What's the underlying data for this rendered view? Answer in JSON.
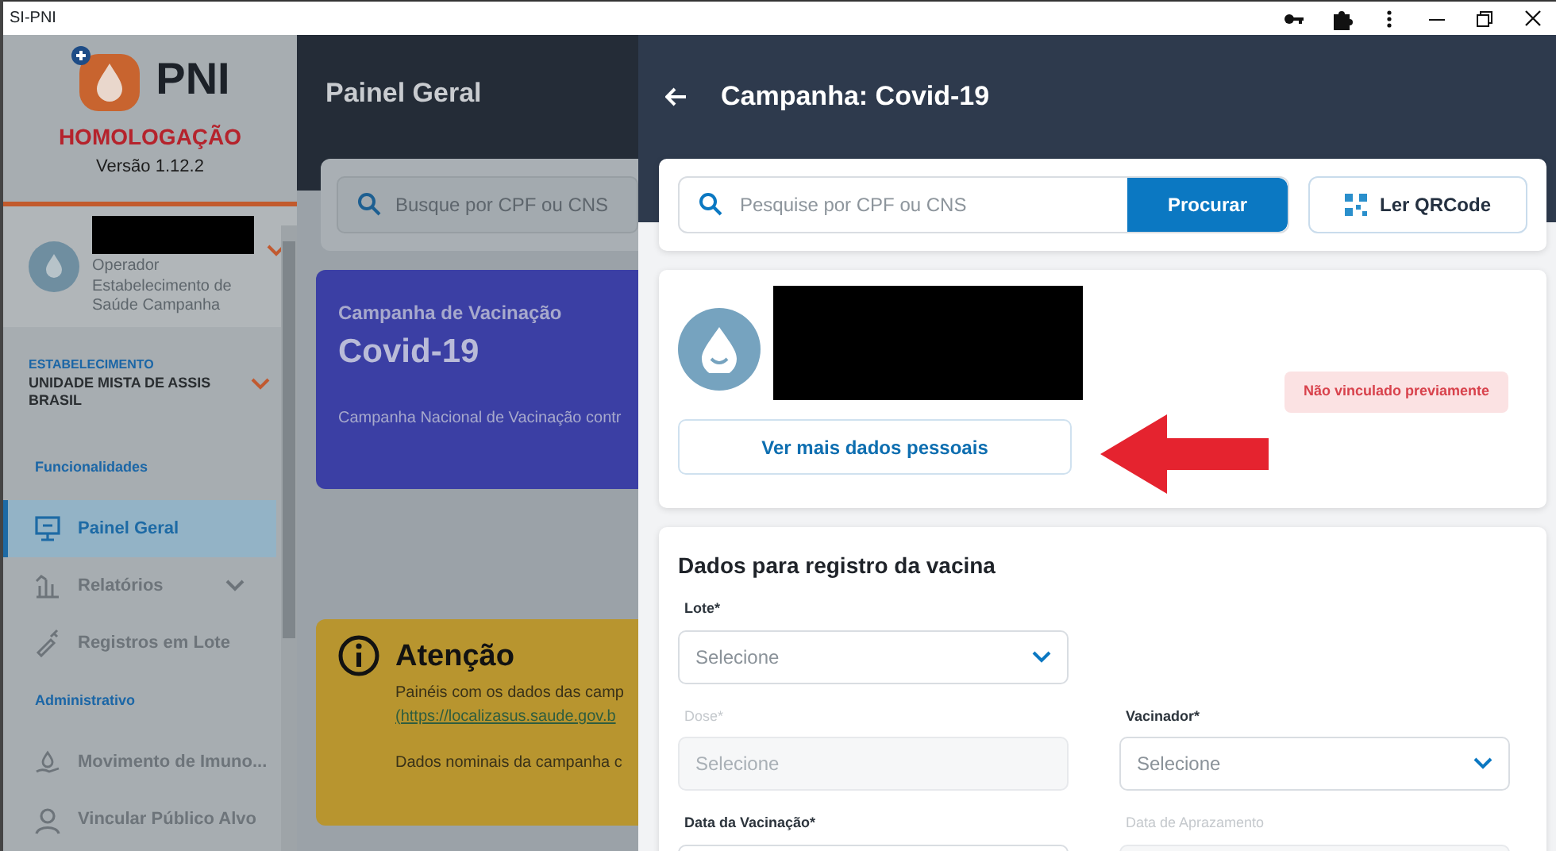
{
  "window": {
    "title": "SI-PNI"
  },
  "sidebar": {
    "logo_text": "PNI",
    "environment": "HOMOLOGAÇÃO",
    "version": "Versão 1.12.2",
    "user": {
      "role": "Operador Estabelecimento de Saúde Campanha"
    },
    "establishment": {
      "heading": "ESTABELECIMENTO",
      "name": "UNIDADE MISTA DE ASSIS BRASIL"
    },
    "sections": [
      {
        "heading": "Funcionalidades",
        "items": [
          {
            "label": "Painel Geral",
            "selected": true,
            "expandable": false
          },
          {
            "label": "Relatórios",
            "selected": false,
            "expandable": true
          },
          {
            "label": "Registros em Lote",
            "selected": false,
            "expandable": false
          }
        ]
      },
      {
        "heading": "Administrativo",
        "items": [
          {
            "label": "Movimento de Imuno...",
            "selected": false,
            "expandable": false
          },
          {
            "label": "Vincular Público Alvo",
            "selected": false,
            "expandable": false
          }
        ]
      }
    ]
  },
  "main": {
    "title": "Painel Geral",
    "search": {
      "placeholder": "Busque por CPF ou CNS"
    },
    "campaign_card": {
      "subtitle": "Campanha de Vacinação",
      "title": "Covid-19",
      "description": "Campanha Nacional de Vacinação contr"
    },
    "notice": {
      "title": "Atenção",
      "lines": [
        {
          "kind": "text",
          "text": "Painéis com os dados das camp"
        },
        {
          "kind": "link",
          "text": "(https://localizasus.saude.gov.b"
        },
        {
          "kind": "text",
          "text": "Dados nominais da campanha c"
        }
      ]
    }
  },
  "drawer": {
    "title": "Campanha: Covid-19",
    "search": {
      "placeholder": "Pesquise por CPF ou CNS",
      "button": "Procurar",
      "qr_button": "Ler QRCode"
    },
    "patient": {
      "status": "Não vinculado previamente",
      "more_button": "Ver mais dados pessoais"
    },
    "form": {
      "title": "Dados para registro da vacina",
      "rows": [
        [
          {
            "label": "Lote*",
            "kind": "select",
            "placeholder": "Selecione",
            "disabled": false
          }
        ],
        [
          {
            "label": "Dose*",
            "kind": "input",
            "placeholder": "Selecione",
            "disabled": true
          },
          {
            "label": "Vacinador*",
            "kind": "select",
            "placeholder": "Selecione",
            "disabled": false
          }
        ],
        [
          {
            "label": "Data da Vacinação*",
            "kind": "input",
            "disabled": false
          },
          {
            "label": "Data de Aprazamento",
            "kind": "input",
            "disabled": true
          }
        ]
      ]
    }
  }
}
